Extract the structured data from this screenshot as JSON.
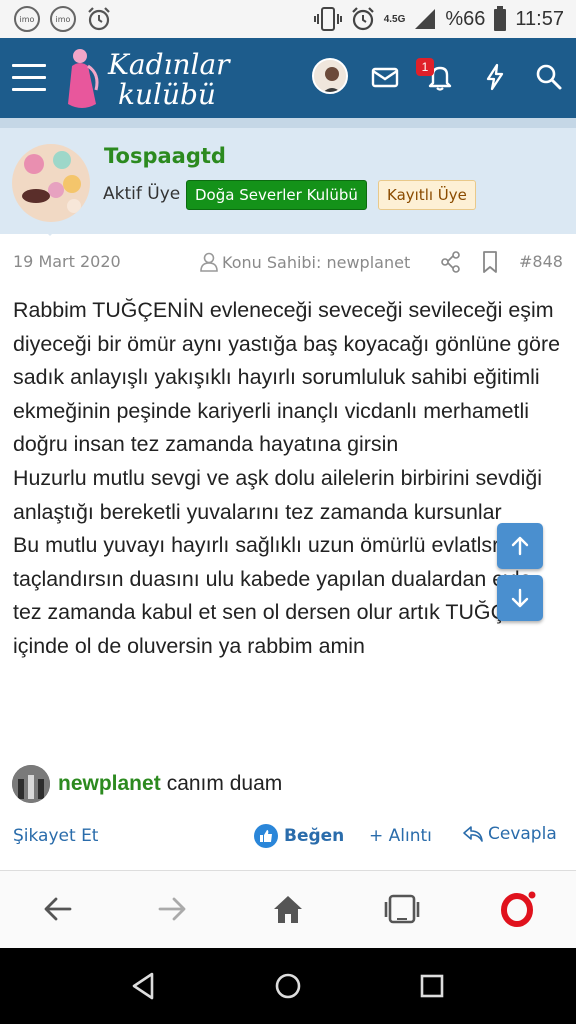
{
  "status_bar": {
    "left_icons": [
      "imo-icon",
      "imo-icon",
      "alarm-icon"
    ],
    "imo_label": "imo",
    "network": "4.5G",
    "battery": "%66",
    "time": "11:57"
  },
  "header": {
    "logo_line1": "Kadınlar",
    "logo_line2": "kulübü",
    "notification_count": "1",
    "accent": "#1d5c8c"
  },
  "user": {
    "name": "Tospaagtd",
    "title": "Aktif Üye",
    "badge_club": "Doğa Severler Kulübü",
    "badge_registered": "Kayıtlı Üye"
  },
  "post": {
    "date": "19 Mart 2020",
    "owner": "Konu Sahibi: newplanet",
    "number": "#848",
    "paragraphs": [
      "Rabbim TUĞÇENİN evleneceği seveceği sevileceği eşim diyeceği bir ömür aynı yastığa baş koyacağı gönlüne göre sadık anlayışlı yakışıklı hayırlı sorumluluk sahibi eğitimli ekmeğinin peşinde kariyerli inançlı vicdanlı merhametli doğru insan tez zamanda hayatına girsin",
      "Huzurlu mutlu sevgi ve aşk dolu ailelerin birbirini sevdiği anlaştığı bereketli yuvalarını tez zamanda kursunlar",
      "Bu mutlu yuvayı hayırlı sağlıklı uzun ömürlü evlatlsrla taçlandırsın duasını ulu kabede yapılan dualardan eyle tez zamanda kabul et sen ol dersen olur artık TUĞÇE içinde ol de oluversin ya rabbim amin"
    ],
    "reaction_user": "newplanet",
    "reaction_text": "canım duam"
  },
  "actions": {
    "report": "Şikayet Et",
    "like": "Beğen",
    "quote": "+ Alıntı",
    "reply": "Cevapla"
  }
}
